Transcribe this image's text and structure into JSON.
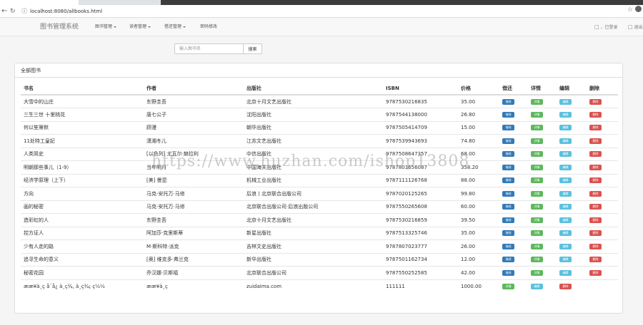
{
  "browser": {
    "url": "localhost:8080/allbooks.html"
  },
  "navbar": {
    "brand": "图书管理系统",
    "items": [
      {
        "label": "图书管理"
      },
      {
        "label": "读者管理"
      },
      {
        "label": "借还管理"
      },
      {
        "label": "密码修改"
      }
    ],
    "login_status": "，已登录",
    "logout": "退出"
  },
  "search": {
    "placeholder": "输入图书名",
    "button": "搜索"
  },
  "panel": {
    "title": "全部图书",
    "columns": [
      "书名",
      "作者",
      "出版社",
      "ISBN",
      "价格",
      "借还",
      "详情",
      "编辑",
      "删除"
    ],
    "buttons": {
      "borrow": "借阅",
      "detail": "详情",
      "edit": "编辑",
      "delete": "删除"
    },
    "rows": [
      {
        "name": "大雪中的山庄",
        "author": "东野圭吾",
        "publisher": "北京十月文艺出版社",
        "isbn": "9787530216835",
        "price": "35.00"
      },
      {
        "name": "三生三世 十里桃花",
        "author": "唐七公子",
        "publisher": "沈阳出版社",
        "isbn": "9787544138000",
        "price": "26.80"
      },
      {
        "name": "何以笙箫默",
        "author": "顾漫",
        "publisher": "朝华出版社",
        "isbn": "9787505414709",
        "price": "15.00"
      },
      {
        "name": "11处特工皇妃",
        "author": "潇湘冬儿",
        "publisher": "江苏文艺出版社",
        "isbn": "9787539943693",
        "price": "74.80"
      },
      {
        "name": "人类简史",
        "author": "[以色列] 尤瓦尔·赫拉利",
        "publisher": "中信出版社",
        "isbn": "9787508647357",
        "price": "68.00"
      },
      {
        "name": "明朝那些事儿（1-9）",
        "author": "当年明月",
        "publisher": "中国海关出版社",
        "isbn": "9787801656087",
        "price": "358.20"
      },
      {
        "name": "经济学原理（上下）",
        "author": "[美] 曼昆",
        "publisher": "机械工业出版社",
        "isbn": "9787111126768",
        "price": "88.00"
      },
      {
        "name": "方向",
        "author": "马克-安托万·马修",
        "publisher": "后浪丨北京联合出版公司",
        "isbn": "9787020125265",
        "price": "99.80"
      },
      {
        "name": "画的秘密",
        "author": "马克-安托万·马修",
        "publisher": "北京联合出版公司·后浪出版公司",
        "isbn": "9787550265608",
        "price": "60.00"
      },
      {
        "name": "造彩虹的人",
        "author": "东野圭吾",
        "publisher": "北京十月文艺出版社",
        "isbn": "9787530216859",
        "price": "39.50"
      },
      {
        "name": "控方证人",
        "author": "阿加莎·克里斯蒂",
        "publisher": "新星出版社",
        "isbn": "9787513325746",
        "price": "35.00"
      },
      {
        "name": "少有人走的路",
        "author": "M·斯科特·派克",
        "publisher": "吉林文史出版社",
        "isbn": "9787807023777",
        "price": "26.00"
      },
      {
        "name": "追寻生命的意义",
        "author": "[奥] 维克多·弗兰克",
        "publisher": "新华出版社",
        "isbn": "9787501162734",
        "price": "12.00"
      },
      {
        "name": "秘密花园",
        "author": "乔汉娜·贝斯福",
        "publisher": "北京联合出版公司",
        "isbn": "9787550252585",
        "price": "42.00"
      },
      {
        "name": "ææ¥ä¸ç å¨å¿ ä¸ç¾, ä¸ç¾¡ ç½½",
        "author": "ææ¥ä¸ç",
        "publisher": "zuidaima.com",
        "isbn": "111111",
        "price": "1000.00"
      }
    ]
  },
  "watermark": "https://www.huzhan.com/ishop13808"
}
